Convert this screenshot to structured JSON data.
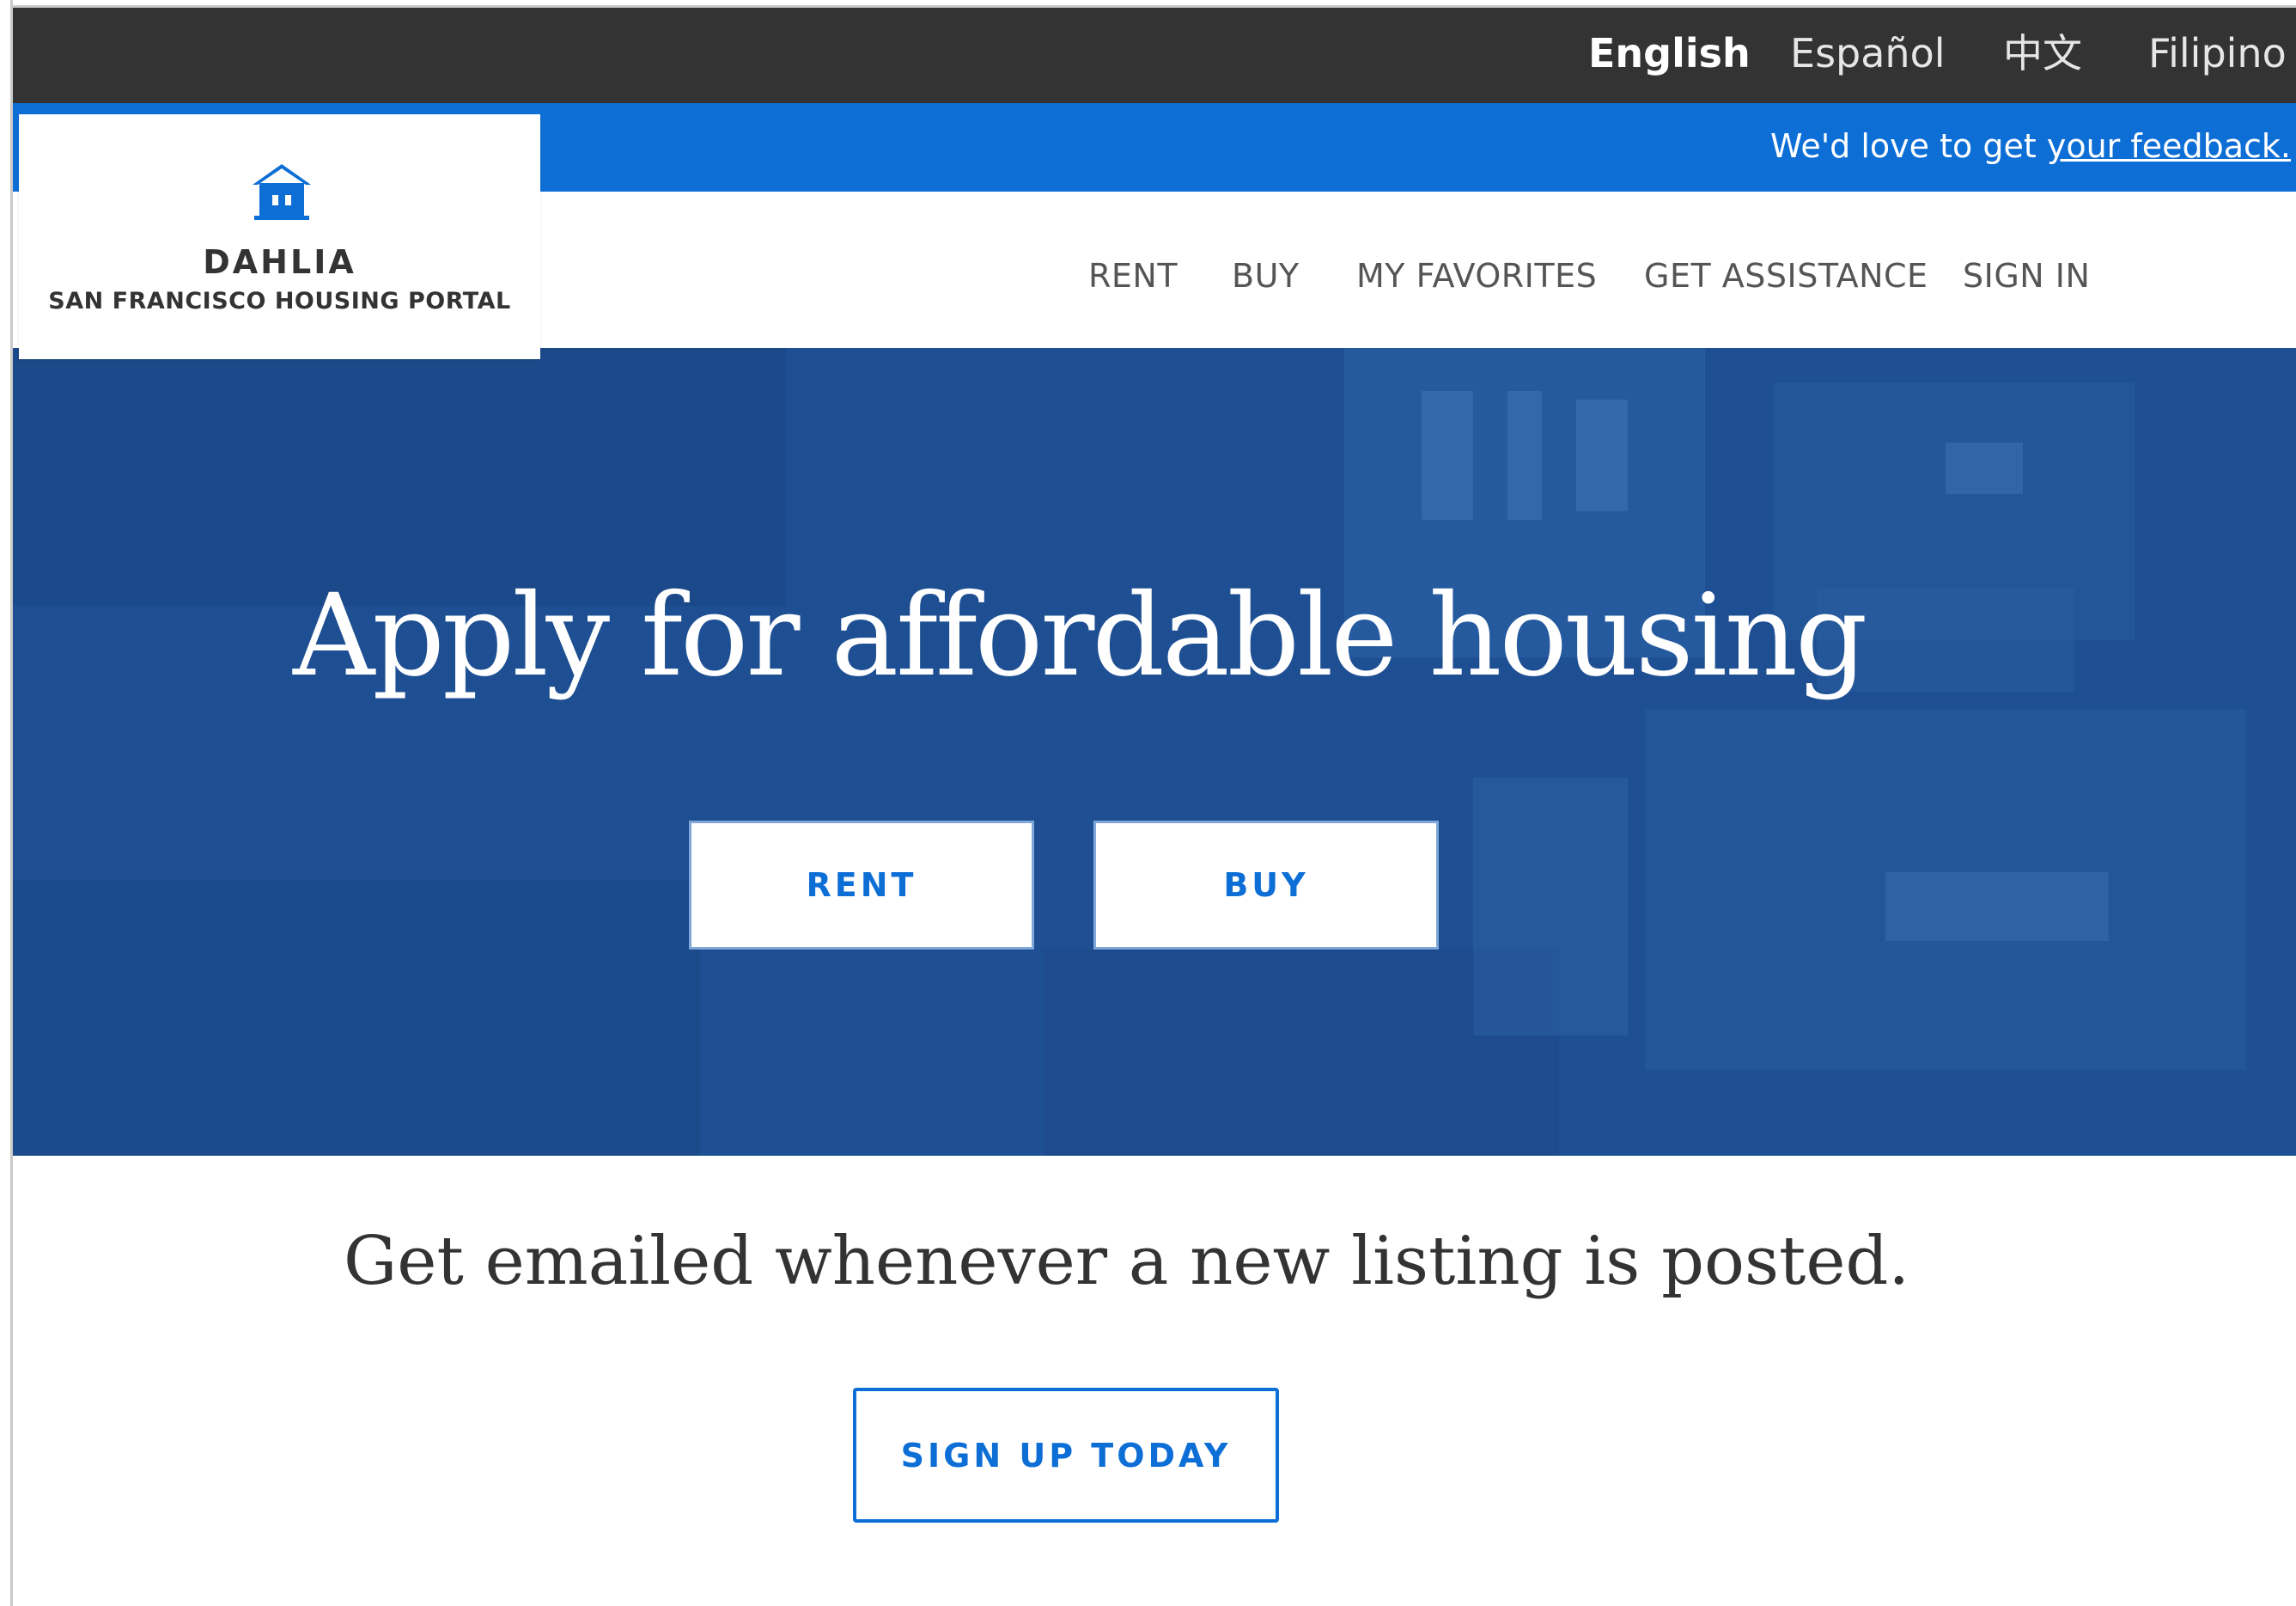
{
  "languages": [
    {
      "label": "English",
      "active": true
    },
    {
      "label": "Español"
    },
    {
      "label": "中文"
    },
    {
      "label": "Filipino"
    }
  ],
  "feedback": {
    "prefix": "We'd love to get ",
    "link": "your feedback."
  },
  "logo": {
    "title": "DAHLIA",
    "subtitle": "SAN FRANCISCO HOUSING PORTAL",
    "icon": "house-icon"
  },
  "nav": {
    "items": [
      "RENT",
      "BUY",
      "MY FAVORITES",
      "GET ASSISTANCE",
      "SIGN IN"
    ]
  },
  "hero": {
    "title": "Apply for affordable housing",
    "rent_button": "RENT",
    "buy_button": "BUY"
  },
  "signup": {
    "text": "Get emailed whenever a new listing is posted.",
    "button": "SIGN UP TODAY"
  },
  "colors": {
    "primary": "#0d6ed6",
    "lang_bar": "#333333",
    "hero_overlay": "#1e4f92",
    "text": "#333333"
  }
}
